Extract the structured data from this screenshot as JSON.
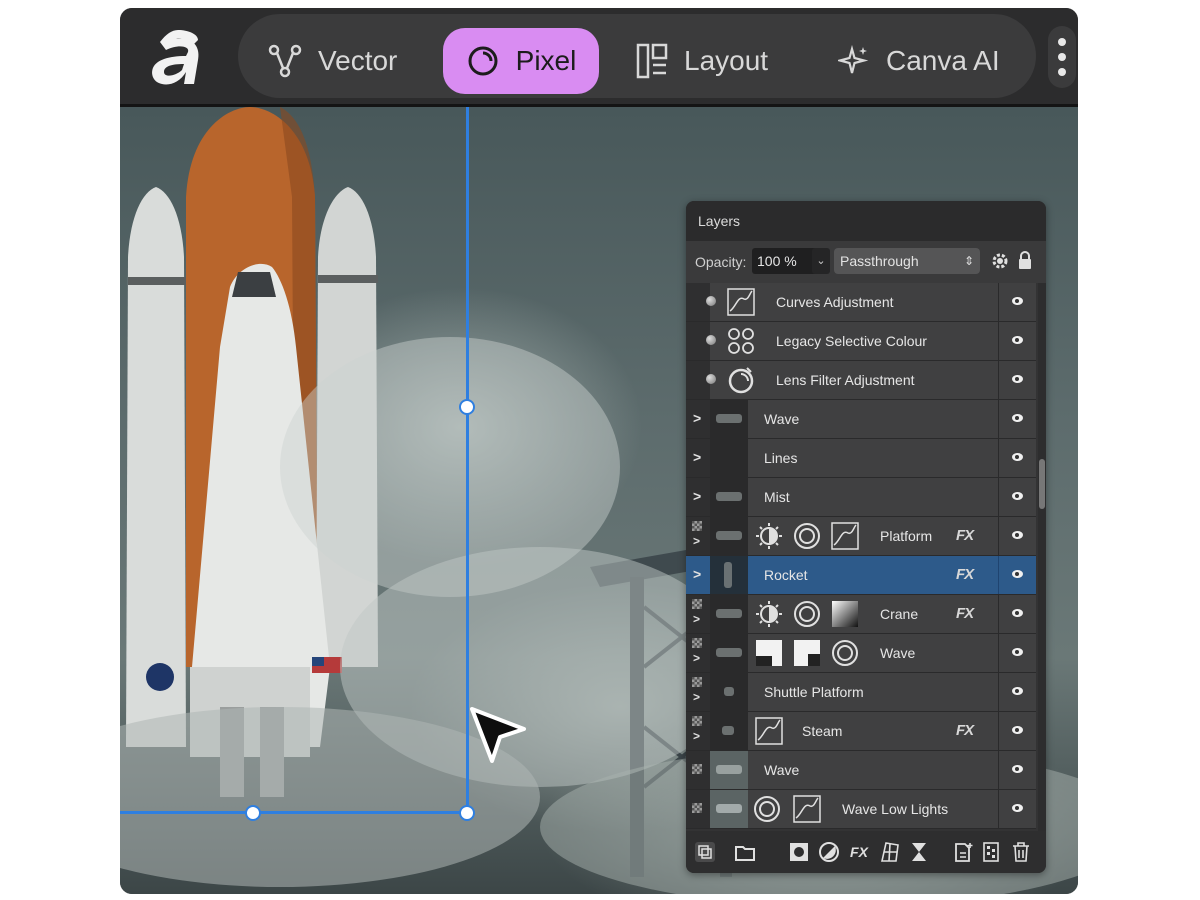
{
  "toolbar": {
    "personas": [
      {
        "label": "Vector",
        "icon": "vector-node-icon",
        "active": false
      },
      {
        "label": "Pixel",
        "icon": "pixel-circle-icon",
        "active": true
      },
      {
        "label": "Layout",
        "icon": "layout-icon",
        "active": false
      },
      {
        "label": "Canva AI",
        "icon": "sparkle-icon",
        "active": false
      }
    ],
    "accent_color": "#d98cf2"
  },
  "layers_panel": {
    "title": "Layers",
    "opacity_label": "Opacity:",
    "opacity_value": "100 %",
    "blend_mode": "Passthrough",
    "layers": [
      {
        "name": "Curves Adjustment",
        "kind": "adjustment"
      },
      {
        "name": "Legacy Selective Colour",
        "kind": "adjustment"
      },
      {
        "name": "Lens Filter Adjustment",
        "kind": "adjustment"
      },
      {
        "name": "Wave",
        "kind": "group"
      },
      {
        "name": "Lines",
        "kind": "group"
      },
      {
        "name": "Mist",
        "kind": "group"
      },
      {
        "name": "Platform",
        "kind": "group",
        "fx": "FX"
      },
      {
        "name": "Rocket",
        "kind": "group",
        "fx": "FX",
        "selected": true
      },
      {
        "name": "Crane",
        "kind": "group",
        "fx": "FX"
      },
      {
        "name": "Wave",
        "kind": "group"
      },
      {
        "name": "Shuttle Platform",
        "kind": "group"
      },
      {
        "name": "Steam",
        "kind": "group",
        "fx": "FX"
      },
      {
        "name": "Wave",
        "kind": "pixel"
      },
      {
        "name": "Wave Low Lights",
        "kind": "pixel"
      }
    ],
    "selection_color": "#2d5a8a",
    "footer_fx": "FX"
  }
}
